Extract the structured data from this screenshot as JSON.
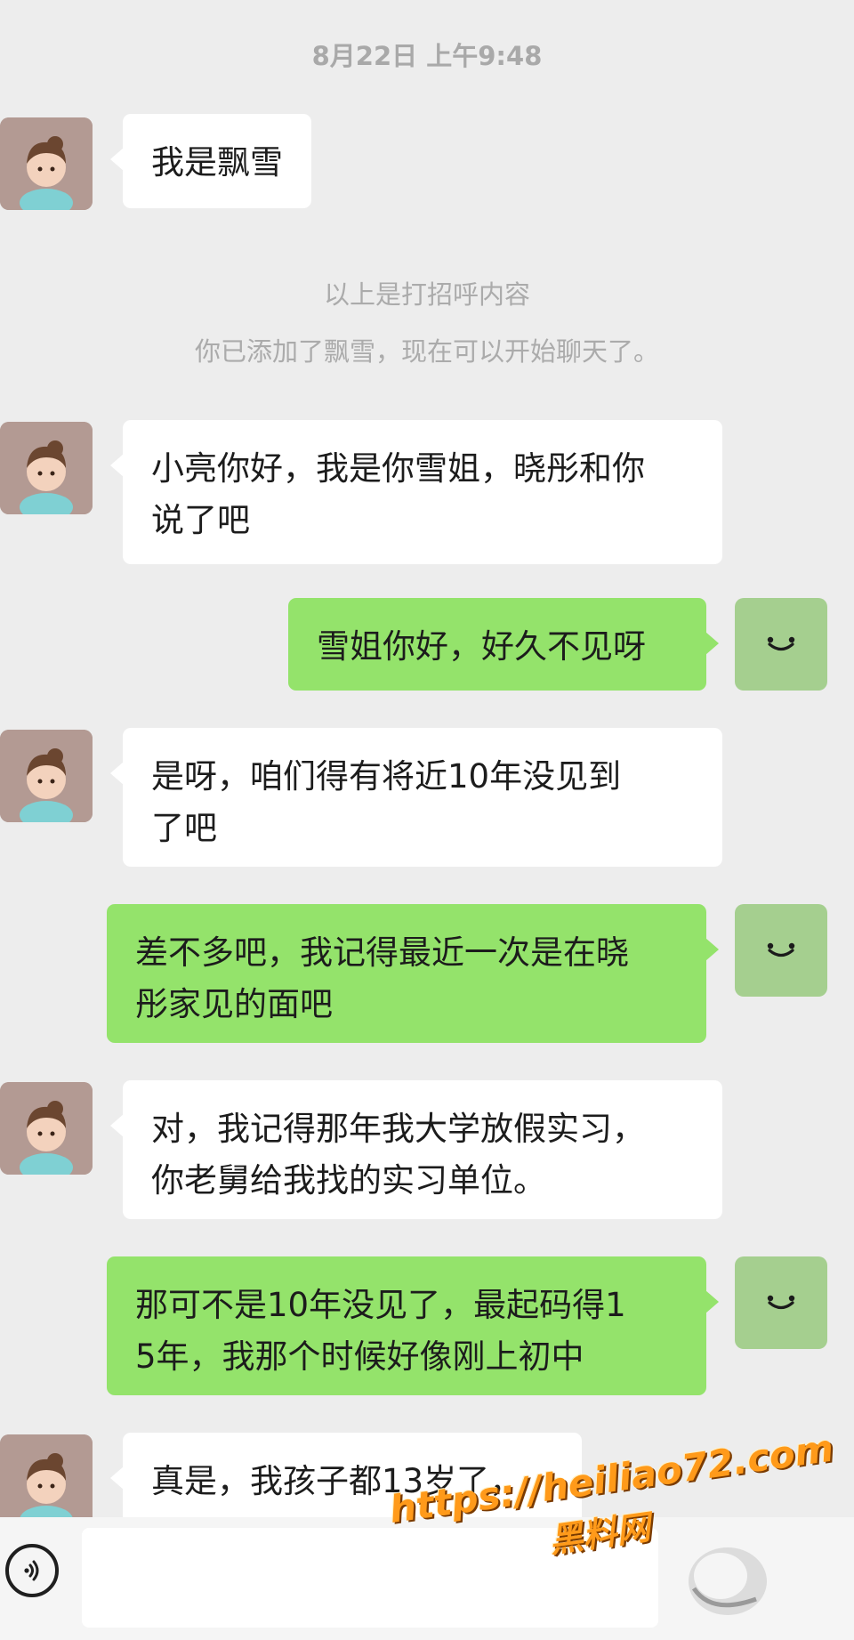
{
  "chat": {
    "timestamp": "8月22日 上午9:48",
    "system_lines": [
      "以上是打招呼内容",
      "你已添加了飘雪，现在可以开始聊天了。"
    ],
    "messages": [
      {
        "side": "left",
        "text": "我是飘雪"
      },
      {
        "side": "left",
        "text": "小亮你好，我是你雪姐，晓彤和你\n说了吧"
      },
      {
        "side": "right",
        "text": "雪姐你好，好久不见呀"
      },
      {
        "side": "left",
        "text": "是呀，咱们得有将近10年没见到\n了吧"
      },
      {
        "side": "right",
        "text": "差不多吧，我记得最近一次是在晓\n彤家见的面吧"
      },
      {
        "side": "left",
        "text": "对，我记得那年我大学放假实习，\n你老舅给我找的实习单位。"
      },
      {
        "side": "right",
        "text": "那可不是10年没见了，最起码得1\n5年，我那个时候好像刚上初中"
      },
      {
        "side": "left",
        "text": "真是，我孩子都13岁了，"
      }
    ]
  },
  "composer": {
    "voice_icon": "voice-icon",
    "input_value": ""
  },
  "watermark": {
    "url": "https://heiliao72.com",
    "name": "黑料网"
  },
  "colors": {
    "background": "#ededed",
    "incoming_bubble": "#ffffff",
    "outgoing_bubble": "#94e36b",
    "watermark": "#ff9a1a"
  }
}
